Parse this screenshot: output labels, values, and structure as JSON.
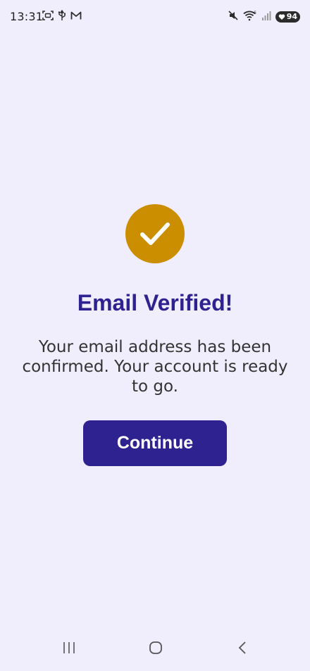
{
  "status_bar": {
    "time": "13:31",
    "battery_level": "94",
    "left_icons": [
      "screenshot-icon",
      "usb-icon",
      "gmail-icon"
    ],
    "right_icons": [
      "mute-icon",
      "wifi-icon",
      "signal-icon",
      "battery-icon"
    ]
  },
  "main": {
    "title": "Email Verified!",
    "message": "Your email address has been confirmed. Your account is ready to go.",
    "continue_label": "Continue"
  },
  "colors": {
    "background": "#f0eefc",
    "primary": "#2e2190",
    "success_badge": "#cb8e00",
    "text": "#333333"
  },
  "nav_bar": {
    "buttons": [
      "recent-apps-icon",
      "home-icon",
      "back-icon"
    ]
  }
}
